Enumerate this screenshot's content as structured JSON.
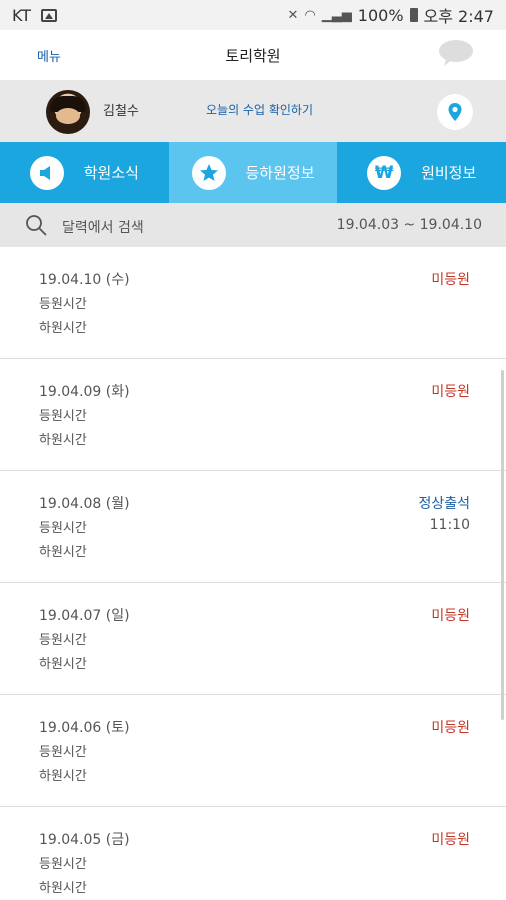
{
  "status_bar": {
    "carrier": "KT",
    "battery": "100%",
    "time": "오후 2:47"
  },
  "appbar": {
    "menu": "메뉴",
    "title": "토리학원"
  },
  "user": {
    "name": "김철수",
    "today_link": "오늘의 수업 확인하기"
  },
  "tabs": [
    {
      "label": "학원소식",
      "icon": "megaphone-icon"
    },
    {
      "label": "등하원정보",
      "icon": "star-icon",
      "active": true
    },
    {
      "label": "원비정보",
      "icon": "won-icon"
    }
  ],
  "search": {
    "placeholder": "달력에서 검색",
    "range": "19.04.03 ~ 19.04.10"
  },
  "colors": {
    "primary": "#1ca6e0",
    "active_tab": "#5cc5ef",
    "absent": "#c0392b",
    "present": "#1a5fa8"
  },
  "entries": [
    {
      "date": "19.04.10 (수)",
      "in_label": "등원시간",
      "out_label": "하원시간",
      "status": "미등원",
      "time": ""
    },
    {
      "date": "19.04.09 (화)",
      "in_label": "등원시간",
      "out_label": "하원시간",
      "status": "미등원",
      "time": ""
    },
    {
      "date": "19.04.08 (월)",
      "in_label": "등원시간",
      "out_label": "하원시간",
      "status": "정상출석",
      "time": "11:10"
    },
    {
      "date": "19.04.07 (일)",
      "in_label": "등원시간",
      "out_label": "하원시간",
      "status": "미등원",
      "time": ""
    },
    {
      "date": "19.04.06 (토)",
      "in_label": "등원시간",
      "out_label": "하원시간",
      "status": "미등원",
      "time": ""
    },
    {
      "date": "19.04.05 (금)",
      "in_label": "등원시간",
      "out_label": "하원시간",
      "status": "미등원",
      "time": ""
    }
  ]
}
